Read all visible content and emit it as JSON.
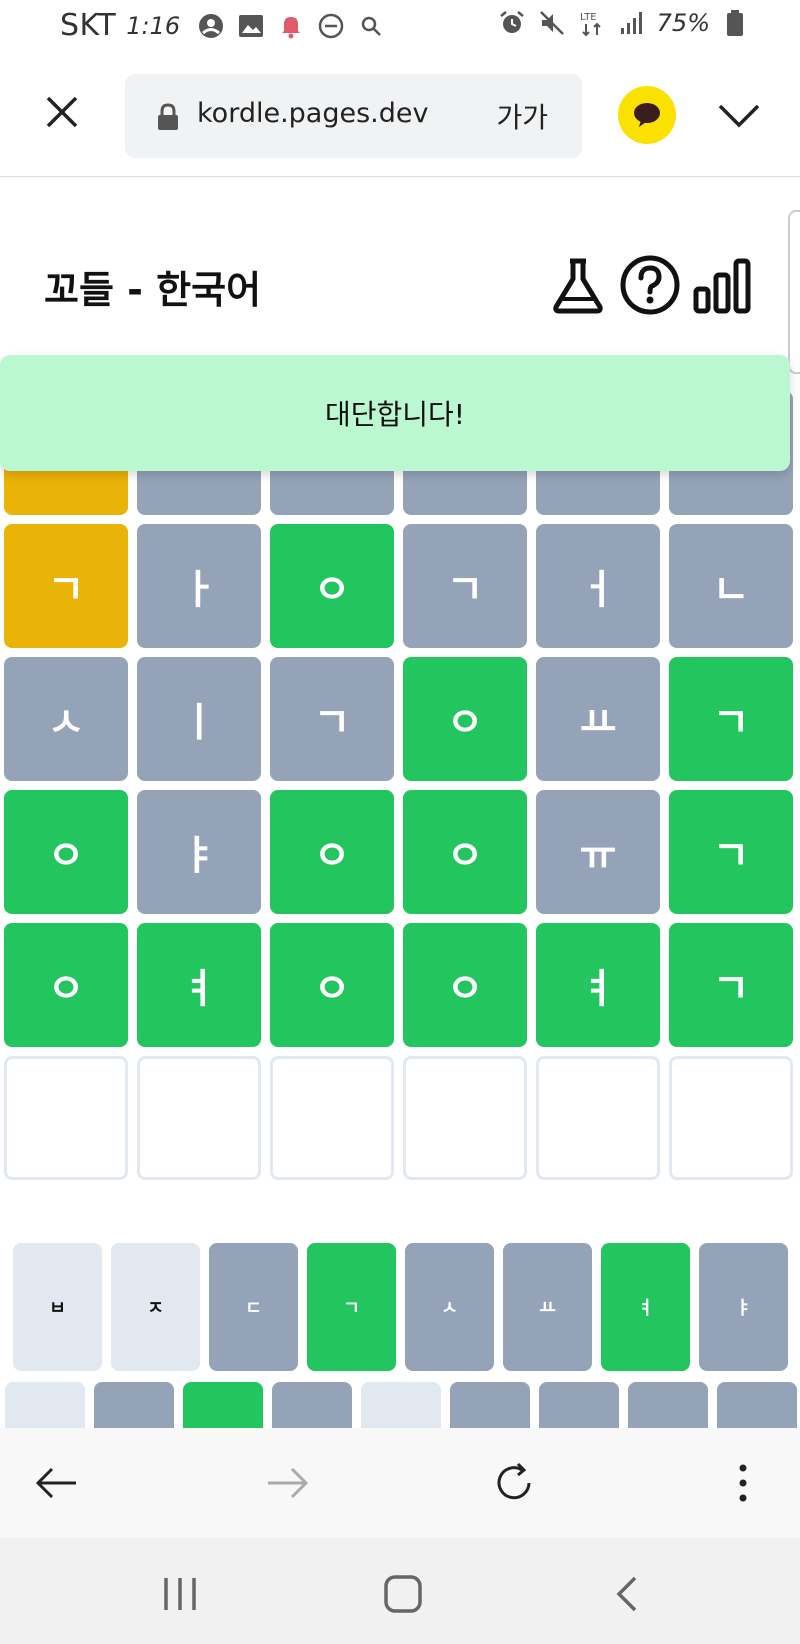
{
  "status_bar": {
    "carrier": "SKT",
    "time": "1:16",
    "battery": "75%",
    "left_icons": [
      "account-circle-icon",
      "image-icon",
      "notification-bell-icon",
      "do-not-disturb-icon",
      "search-icon"
    ],
    "right_icons": [
      "alarm-icon",
      "mute-icon",
      "lte-icon",
      "signal-icon",
      "battery-icon"
    ],
    "lte_label": "LTE"
  },
  "browser": {
    "url": "kordle.pages.dev",
    "zoom_label": "가가"
  },
  "header": {
    "title": "꼬들 - 한국어"
  },
  "toast": {
    "message": "대단합니다!"
  },
  "colors": {
    "correct": "#22c55e",
    "present": "#eab308",
    "absent": "#94a3b8",
    "unused": "#e2e8f0",
    "toast_bg": "#bbf7d0",
    "kakao": "#fae100"
  },
  "board": {
    "rows": [
      [
        {
          "letter": "",
          "state": "present"
        },
        {
          "letter": "",
          "state": "absent"
        },
        {
          "letter": "",
          "state": "absent"
        },
        {
          "letter": "",
          "state": "absent"
        },
        {
          "letter": "",
          "state": "absent"
        },
        {
          "letter": "",
          "state": "absent"
        }
      ],
      [
        {
          "letter": "ㄱ",
          "state": "present"
        },
        {
          "letter": "ㅏ",
          "state": "absent"
        },
        {
          "letter": "ㅇ",
          "state": "correct"
        },
        {
          "letter": "ㄱ",
          "state": "absent"
        },
        {
          "letter": "ㅓ",
          "state": "absent"
        },
        {
          "letter": "ㄴ",
          "state": "absent"
        }
      ],
      [
        {
          "letter": "ㅅ",
          "state": "absent"
        },
        {
          "letter": "ㅣ",
          "state": "absent"
        },
        {
          "letter": "ㄱ",
          "state": "absent"
        },
        {
          "letter": "ㅇ",
          "state": "correct"
        },
        {
          "letter": "ㅛ",
          "state": "absent"
        },
        {
          "letter": "ㄱ",
          "state": "correct"
        }
      ],
      [
        {
          "letter": "ㅇ",
          "state": "correct"
        },
        {
          "letter": "ㅑ",
          "state": "absent"
        },
        {
          "letter": "ㅇ",
          "state": "correct"
        },
        {
          "letter": "ㅇ",
          "state": "correct"
        },
        {
          "letter": "ㅠ",
          "state": "absent"
        },
        {
          "letter": "ㄱ",
          "state": "correct"
        }
      ],
      [
        {
          "letter": "ㅇ",
          "state": "correct"
        },
        {
          "letter": "ㅕ",
          "state": "correct"
        },
        {
          "letter": "ㅇ",
          "state": "correct"
        },
        {
          "letter": "ㅇ",
          "state": "correct"
        },
        {
          "letter": "ㅕ",
          "state": "correct"
        },
        {
          "letter": "ㄱ",
          "state": "correct"
        }
      ],
      [
        {
          "letter": "",
          "state": "empty"
        },
        {
          "letter": "",
          "state": "empty"
        },
        {
          "letter": "",
          "state": "empty"
        },
        {
          "letter": "",
          "state": "empty"
        },
        {
          "letter": "",
          "state": "empty"
        },
        {
          "letter": "",
          "state": "empty"
        }
      ]
    ]
  },
  "keyboard": {
    "row1": [
      {
        "label": "ㅂ",
        "state": "unused"
      },
      {
        "label": "ㅈ",
        "state": "unused"
      },
      {
        "label": "ㄷ",
        "state": "absent"
      },
      {
        "label": "ㄱ",
        "state": "correct"
      },
      {
        "label": "ㅅ",
        "state": "absent"
      },
      {
        "label": "ㅛ",
        "state": "absent"
      },
      {
        "label": "ㅕ",
        "state": "correct"
      },
      {
        "label": "ㅑ",
        "state": "absent"
      }
    ],
    "row2": [
      {
        "label": "",
        "state": "unused"
      },
      {
        "label": "",
        "state": "absent"
      },
      {
        "label": "",
        "state": "correct"
      },
      {
        "label": "",
        "state": "absent"
      },
      {
        "label": "",
        "state": "unused"
      },
      {
        "label": "",
        "state": "absent"
      },
      {
        "label": "",
        "state": "absent"
      },
      {
        "label": "",
        "state": "absent"
      },
      {
        "label": "",
        "state": "absent"
      }
    ]
  }
}
